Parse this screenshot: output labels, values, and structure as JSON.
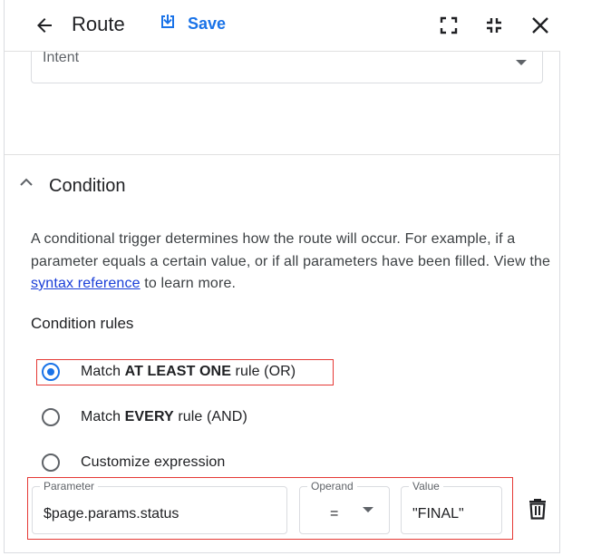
{
  "header": {
    "title": "Route",
    "save_label": "Save"
  },
  "intent": {
    "label": "Intent"
  },
  "condition": {
    "title": "Condition",
    "description_before": "A conditional trigger determines how the route will occur. For example, if a parameter equals a certain value, or if all parameters have been filled. View the ",
    "link_text": "syntax reference",
    "description_after": " to learn more.",
    "rules_title": "Condition rules",
    "options": [
      {
        "prefix": "Match ",
        "bold": "AT LEAST ONE",
        "suffix": " rule (OR)",
        "selected": true
      },
      {
        "prefix": "Match ",
        "bold": "EVERY",
        "suffix": " rule (AND)",
        "selected": false
      },
      {
        "prefix": "Customize expression",
        "bold": "",
        "suffix": "",
        "selected": false
      }
    ],
    "rule": {
      "parameter_label": "Parameter",
      "parameter_value": "$page.params.status",
      "operand_label": "Operand",
      "operand_value": "=",
      "value_label": "Value",
      "value_value": "\"FINAL\""
    }
  },
  "colors": {
    "accent": "#1a73e8",
    "highlight": "#e53935"
  }
}
